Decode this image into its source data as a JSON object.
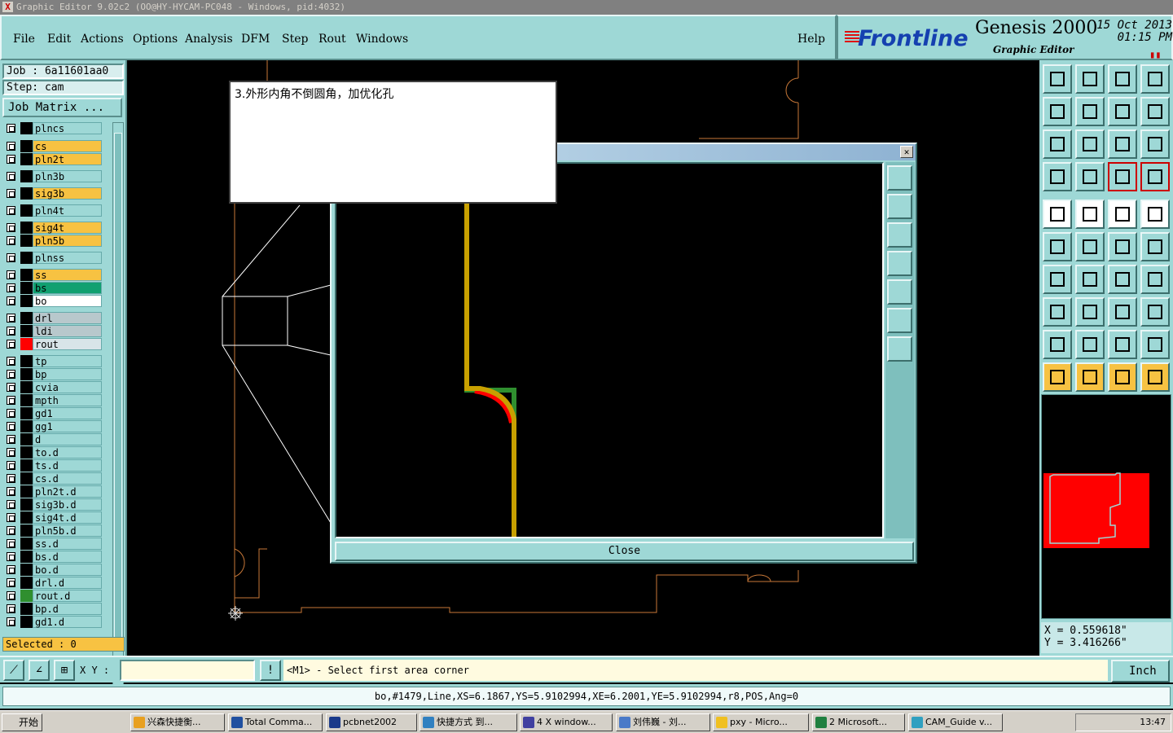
{
  "window": {
    "title": "Graphic Editor 9.02c2 (OO@HY-HYCAM-PC048 - Windows, pid:4032)"
  },
  "menu": {
    "items": [
      "File",
      "Edit",
      "Actions",
      "Options",
      "Analysis",
      "DFM",
      "Step",
      "Rout",
      "Windows"
    ],
    "help": "Help"
  },
  "brand": {
    "logo": "Frontline",
    "product": "Genesis 2000",
    "subtitle": "Graphic Editor",
    "date": "15 Oct 2013",
    "time": "01:15 PM"
  },
  "job": {
    "job_line": "Job : 6a11601aa0",
    "step_line": "Step: cam",
    "matrix_button": "Job Matrix ..."
  },
  "layers": [
    {
      "name": "plncs",
      "color": "#9ed8d6",
      "swatch": "#000000"
    },
    {
      "name": "cs",
      "color": "#f7c242",
      "swatch": "#000000"
    },
    {
      "name": "pln2t",
      "color": "#f7c242",
      "swatch": "#000000"
    },
    {
      "name": "pln3b",
      "color": "#9ed8d6",
      "swatch": "#000000"
    },
    {
      "name": "sig3b",
      "color": "#f7c242",
      "swatch": "#000000"
    },
    {
      "name": "pln4t",
      "color": "#9ed8d6",
      "swatch": "#000000"
    },
    {
      "name": "sig4t",
      "color": "#f7c242",
      "swatch": "#000000"
    },
    {
      "name": "pln5b",
      "color": "#f7c242",
      "swatch": "#000000"
    },
    {
      "name": "plnss",
      "color": "#9ed8d6",
      "swatch": "#000000"
    },
    {
      "name": "ss",
      "color": "#f7c242",
      "swatch": "#000000"
    },
    {
      "name": "bs",
      "color": "#10a070",
      "swatch": "#000000"
    },
    {
      "name": "bo",
      "color": "#ffffff",
      "swatch": "#000000"
    },
    {
      "name": "drl",
      "color": "#b8c8cc",
      "swatch": "#000000"
    },
    {
      "name": "ldi",
      "color": "#b8c8cc",
      "swatch": "#000000"
    },
    {
      "name": "rout",
      "color": "#d8e4e8",
      "swatch": "#ff0000"
    },
    {
      "name": "tp",
      "color": "#9ed8d6",
      "swatch": "#000000"
    },
    {
      "name": "bp",
      "color": "#9ed8d6",
      "swatch": "#000000"
    },
    {
      "name": "cvia",
      "color": "#9ed8d6",
      "swatch": "#000000"
    },
    {
      "name": "mpth",
      "color": "#9ed8d6",
      "swatch": "#000000"
    },
    {
      "name": "gd1",
      "color": "#9ed8d6",
      "swatch": "#000000"
    },
    {
      "name": "gg1",
      "color": "#9ed8d6",
      "swatch": "#000000"
    },
    {
      "name": "d",
      "color": "#9ed8d6",
      "swatch": "#000000"
    },
    {
      "name": "to.d",
      "color": "#9ed8d6",
      "swatch": "#000000"
    },
    {
      "name": "ts.d",
      "color": "#9ed8d6",
      "swatch": "#000000"
    },
    {
      "name": "cs.d",
      "color": "#9ed8d6",
      "swatch": "#000000"
    },
    {
      "name": "pln2t.d",
      "color": "#9ed8d6",
      "swatch": "#000000"
    },
    {
      "name": "sig3b.d",
      "color": "#9ed8d6",
      "swatch": "#000000"
    },
    {
      "name": "sig4t.d",
      "color": "#9ed8d6",
      "swatch": "#000000"
    },
    {
      "name": "pln5b.d",
      "color": "#9ed8d6",
      "swatch": "#000000"
    },
    {
      "name": "ss.d",
      "color": "#9ed8d6",
      "swatch": "#000000"
    },
    {
      "name": "bs.d",
      "color": "#9ed8d6",
      "swatch": "#000000"
    },
    {
      "name": "bo.d",
      "color": "#9ed8d6",
      "swatch": "#000000"
    },
    {
      "name": "drl.d",
      "color": "#9ed8d6",
      "swatch": "#000000"
    },
    {
      "name": "rout.d",
      "color": "#9ed8d6",
      "swatch": "#2f8f2f"
    },
    {
      "name": "bp.d",
      "color": "#9ed8d6",
      "swatch": "#000000"
    },
    {
      "name": "gd1.d",
      "color": "#9ed8d6",
      "swatch": "#000000"
    }
  ],
  "selected_label": "Selected : 0",
  "note": {
    "text": "3.外形内角不倒圆角，加优化孔"
  },
  "dialog": {
    "close_label": "Close"
  },
  "coords": {
    "x": "X = 0.559618\"",
    "y": "Y = 3.416266\""
  },
  "cmd": {
    "xy_label": "X Y :",
    "prompt": "<M1> - Select first area corner",
    "unit": "Inch"
  },
  "status": "bo,#1479,Line,XS=6.1867,YS=5.9102994,XE=6.2001,YE=5.9102994,r8,POS,Ang=0",
  "taskbar": {
    "start": "开始",
    "tasks": [
      "兴森快捷衡...",
      "Total Comma...",
      "pcbnet2002",
      "快捷方式 到...",
      "4 X window...",
      "刘伟巍 - 刘...",
      "pxy - Micro...",
      "2 Microsoft...",
      "CAM_Guide v..."
    ],
    "clock": "13:47"
  },
  "colors": {
    "panel": "#9ed8d6",
    "highlight": "#f7c242",
    "outline": "#c87838"
  }
}
